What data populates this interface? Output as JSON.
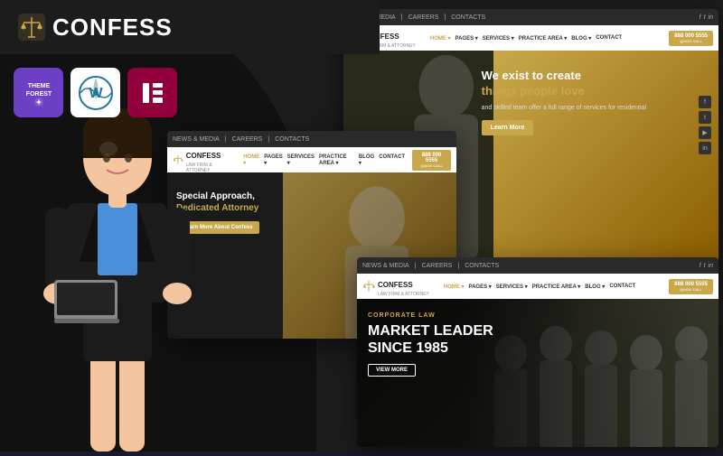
{
  "header": {
    "logo_text": "Confess",
    "logo_icon": "⚖",
    "title": "Confess"
  },
  "badges": {
    "themeforest_label": "TF",
    "wordpress_label": "W",
    "elementor_label": "E"
  },
  "preview1": {
    "top_bar": {
      "links": [
        "NEWS & MEDIA",
        "CAREERS",
        "CONTACTS"
      ],
      "phone": "888 000 5555",
      "phone_sub": "QUICK CALL"
    },
    "nav": {
      "logo": "CONFESS",
      "logo_sub": "LAW FIRM & ATTORNEY",
      "items": [
        "HOME",
        "PAGES",
        "SERVICES",
        "PRACTICE AREA",
        "BLOG",
        "CONTACT"
      ],
      "phone": "888 000 5555",
      "phone_sub": "QUICK CALL"
    },
    "hero": {
      "headline_line1": "We exist to create",
      "headline_line2": "things people love",
      "sub_text": "and skilled team offer a full range of services for residential",
      "button_label": "Learn More"
    }
  },
  "preview2": {
    "top_bar": {
      "links": [
        "NEWS & MEDIA",
        "CAREERS",
        "CONTACTS"
      ]
    },
    "nav": {
      "logo": "CONFESS",
      "logo_sub": "LAW FIRM & ATTORNEY",
      "items": [
        "HOME",
        "PAGES",
        "SERVICES",
        "PRACTICE AREA",
        "BLOG",
        "CONTACT"
      ],
      "phone": "888 000 5555",
      "phone_sub": "QUICK CALL"
    },
    "hero": {
      "headline_line1": "Special Approach,",
      "headline_line2": "Dedicated Attorney",
      "button_label": "Learn More About Confess"
    }
  },
  "preview3": {
    "top_bar": {
      "links": [
        "NEWS & MEDIA",
        "CAREERS",
        "CONTACTS"
      ]
    },
    "nav": {
      "logo": "CONFESS",
      "logo_sub": "LAW FIRM & ATTORNEY",
      "items": [
        "HOME",
        "PAGES",
        "SERVICES",
        "PRACTICE AREA",
        "BLOG",
        "CONTACT"
      ],
      "phone": "888 000 5555",
      "phone_sub": "QUICK CALL"
    },
    "hero": {
      "category": "CORPORATE LAW",
      "headline_line1": "MARKET LEADER",
      "headline_line2": "SINCE 1985",
      "button_label": "VIEW MORE"
    }
  },
  "colors": {
    "gold": "#c9a84c",
    "dark": "#1c1c1c",
    "white": "#ffffff",
    "dark_bg": "#111111"
  }
}
